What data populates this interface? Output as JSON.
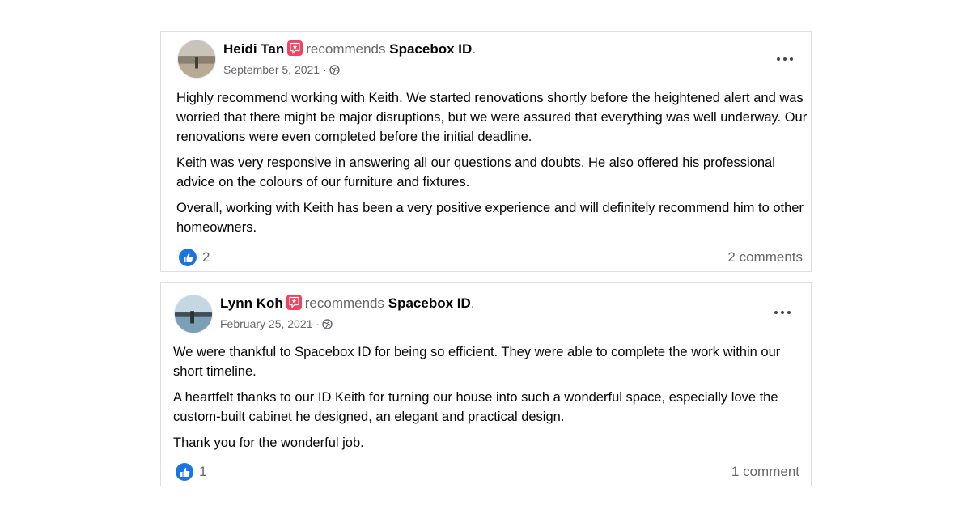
{
  "posts": [
    {
      "author": "Heidi Tan",
      "action": "recommends",
      "page": "Spacebox ID",
      "date": "September 5, 2021",
      "separator": "·",
      "body": [
        "Highly recommend working with Keith. We started renovations shortly before the heightened alert and was worried that there might be major disruptions, but we were assured that everything was well underway. Our renovations were even completed before the initial deadline.",
        "Keith was very responsive in answering all our questions and doubts. He also offered his professional advice on the colours of our furniture and fixtures.",
        "Overall, working with Keith has been a very positive experience and will definitely recommend him to other homeowners."
      ],
      "like_count": "2",
      "comments_label": "2 comments"
    },
    {
      "author": "Lynn Koh",
      "action": "recommends",
      "page": "Spacebox ID",
      "date": "February 25, 2021",
      "separator": "·",
      "body": [
        "We were thankful to Spacebox ID for being so efficient. They were able to complete the work within our short timeline.",
        "A heartfelt thanks to our ID Keith for turning our house into such a wonderful space, especially love the custom-built cabinet he designed, an elegant and practical design.",
        "Thank you for the wonderful job."
      ],
      "like_count": "1",
      "comments_label": "1 comment"
    }
  ],
  "icons": {
    "recommend_badge": "recommend-star-badge-icon",
    "privacy": "globe-icon",
    "menu": "more-options-icon",
    "reaction": "like-icon"
  },
  "colors": {
    "badge": "#f3425f",
    "like": "#1b74e4",
    "secondary_text": "#65676b"
  }
}
